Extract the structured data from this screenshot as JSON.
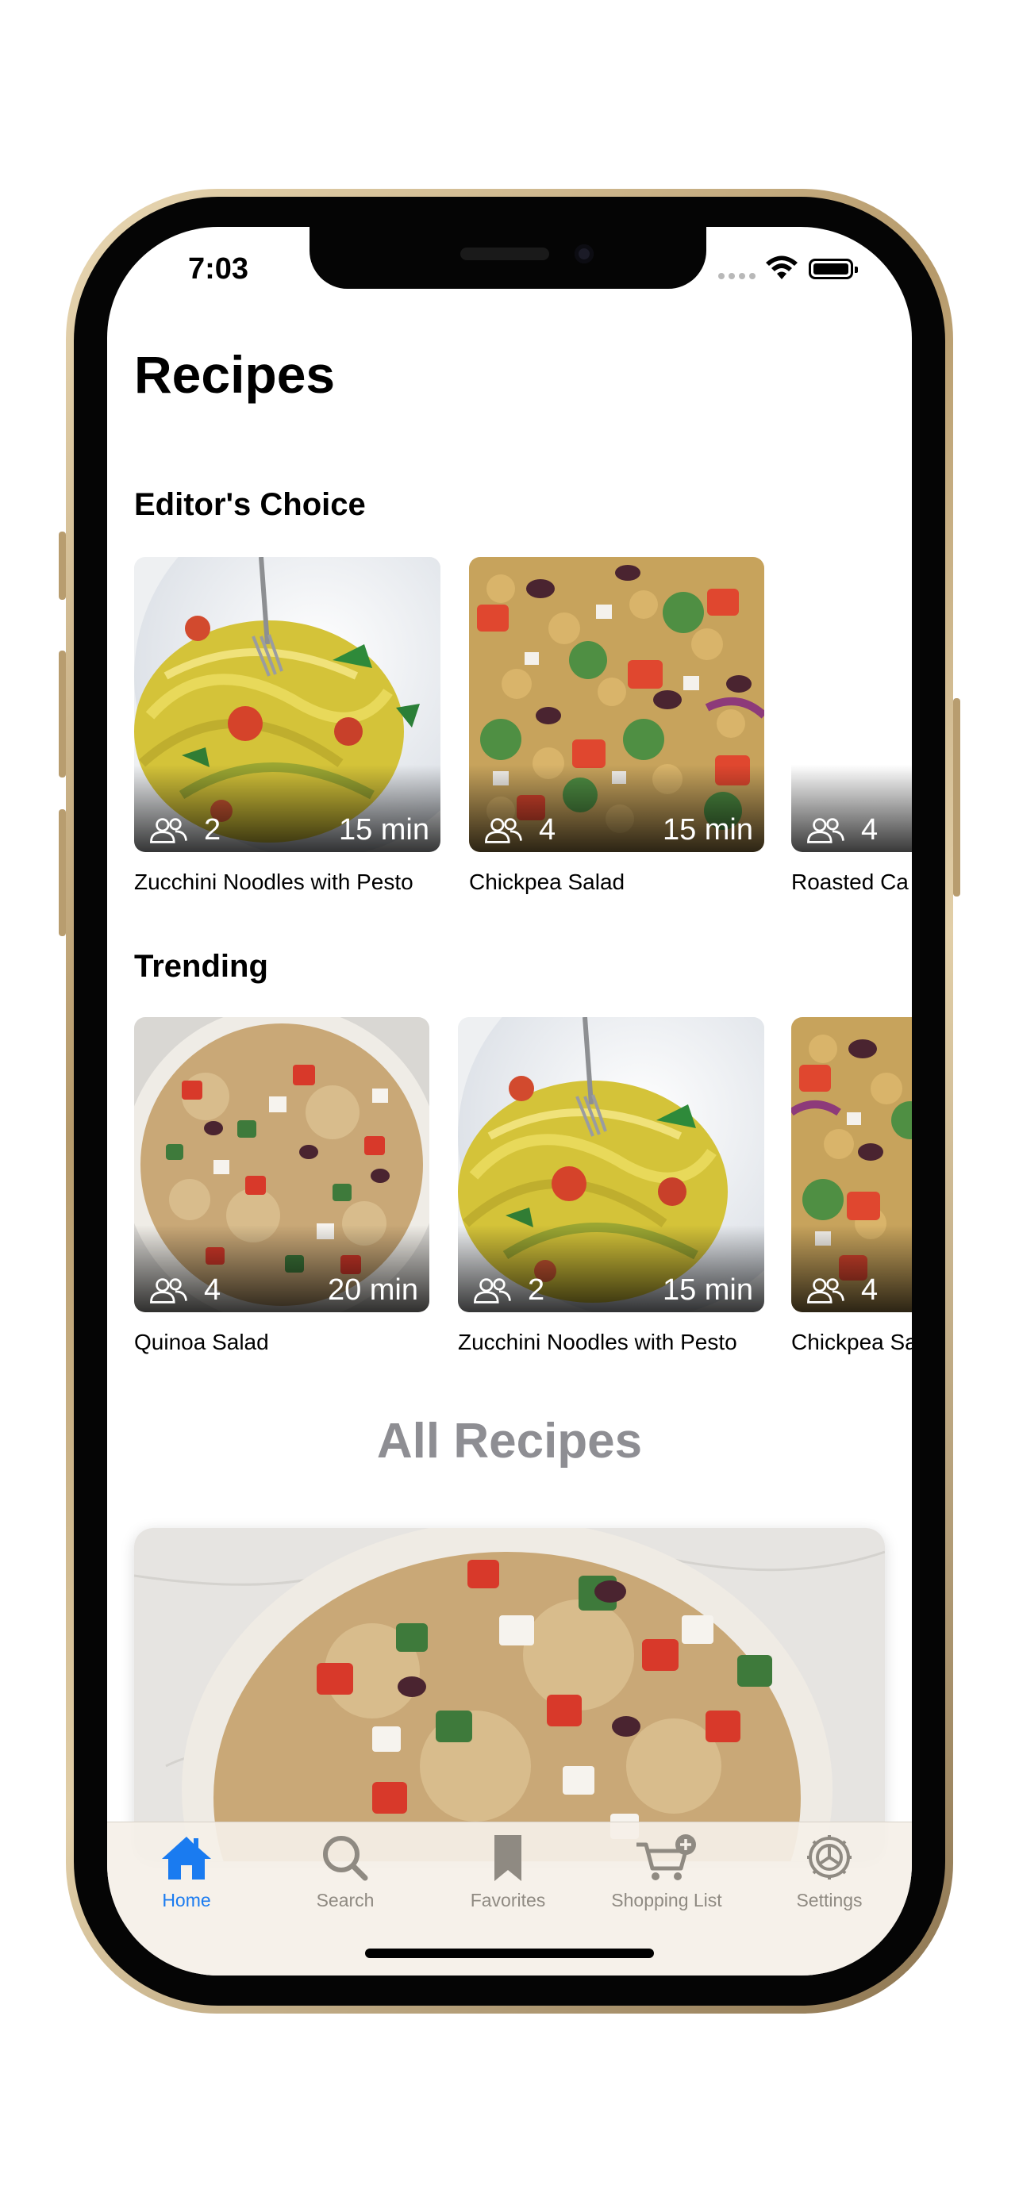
{
  "status_bar": {
    "time": "7:03"
  },
  "header": {
    "title": "Recipes"
  },
  "editors_choice": {
    "title": "Editor's Choice",
    "items": [
      {
        "name": "Zucchini Noodles with Pesto",
        "servings": "2",
        "time": "15 min",
        "image": "zucchini"
      },
      {
        "name": "Chickpea Salad",
        "servings": "4",
        "time": "15 min",
        "image": "chickpea"
      },
      {
        "name": "Roasted Ca",
        "servings": "4",
        "time": "",
        "image": "blank"
      }
    ]
  },
  "trending": {
    "title": "Trending",
    "items": [
      {
        "name": "Quinoa Salad",
        "servings": "4",
        "time": "20 min",
        "image": "quinoa"
      },
      {
        "name": "Zucchini Noodles with Pesto",
        "servings": "2",
        "time": "15 min",
        "image": "zucchini"
      },
      {
        "name": "Chickpea Sa",
        "servings": "4",
        "time": "",
        "image": "chickpea"
      }
    ]
  },
  "all_recipes": {
    "title": "All Recipes"
  },
  "tab_bar": {
    "tabs": [
      {
        "label": "Home",
        "icon": "house-icon",
        "active": true
      },
      {
        "label": "Search",
        "icon": "magnifyingglass-icon",
        "active": false
      },
      {
        "label": "Favorites",
        "icon": "bookmark-icon",
        "active": false
      },
      {
        "label": "Shopping List",
        "icon": "cart-plus-icon",
        "active": false
      },
      {
        "label": "Settings",
        "icon": "gear-icon",
        "active": false
      }
    ]
  },
  "colors": {
    "accent": "#1a7bf0",
    "inactive_tab": "#8f8a82",
    "section_gray": "#8e8e93"
  }
}
